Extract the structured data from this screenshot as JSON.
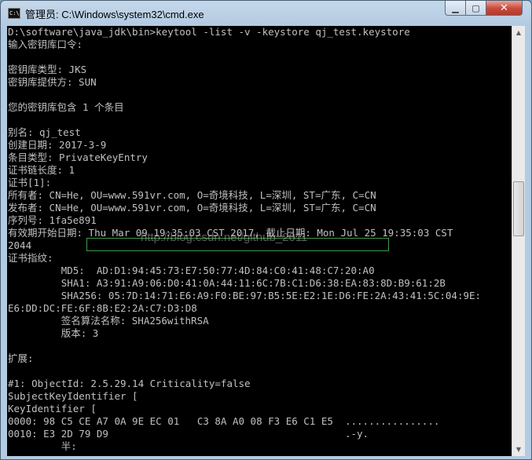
{
  "window": {
    "title": "管理员: C:\\Windows\\system32\\cmd.exe",
    "icon": "cmd-icon",
    "icon_text": "C:\\"
  },
  "controls": {
    "minimize": "▁",
    "maximize": "▢",
    "close": "✕"
  },
  "console": {
    "lines": [
      "D:\\software\\java_jdk\\bin>keytool -list -v -keystore qj_test.keystore",
      "输入密钥库口令:",
      "",
      "密钥库类型: JKS",
      "密钥库提供方: SUN",
      "",
      "您的密钥库包含 1 个条目",
      "",
      "别名: qj_test",
      "创建日期: 2017-3-9",
      "条目类型: PrivateKeyEntry",
      "证书链长度: 1",
      "证书[1]:",
      "所有者: CN=He, OU=www.591vr.com, O=奇境科技, L=深圳, ST=广东, C=CN",
      "发布者: CN=He, OU=www.591vr.com, O=奇境科技, L=深圳, ST=广东, C=CN",
      "序列号: 1fa5e891",
      "有效期开始日期: Thu Mar 09 19:35:03 CST 2017, 截止日期: Mon Jul 25 19:35:03 CST",
      "2044",
      "证书指纹:",
      "         MD5:  AD:D1:94:45:73:E7:50:77:4D:84:C0:41:48:C7:20:A0",
      "         SHA1: A3:91:A9:06:D0:41:0A:44:11:6C:7B:C1:D6:38:EA:83:8D:B9:61:2B",
      "         SHA256: 05:7D:14:71:E6:A9:F0:BE:97:B5:5E:E2:1E:D6:FE:2A:43:41:5C:04:9E:",
      "E6:DD:DC:FE:6F:8B:E2:2A:C7:D3:D8",
      "         签名算法名称: SHA256withRSA",
      "         版本: 3",
      "",
      "扩展:",
      "",
      "#1: ObjectId: 2.5.29.14 Criticality=false",
      "SubjectKeyIdentifier [",
      "KeyIdentifier [",
      "0000: 98 C5 CE A7 0A 9E EC 01   C3 8A A0 08 F3 E6 C1 E5  ................",
      "0010: E3 2D 79 D9                                        .-y.",
      "         半:"
    ]
  },
  "watermark": "http://blog.csdn.net/github_2011",
  "colors": {
    "console_bg": "#000000",
    "console_text": "#c0c0c0",
    "highlight_border": "#3f9a4a",
    "close_button": "#c7483a"
  }
}
